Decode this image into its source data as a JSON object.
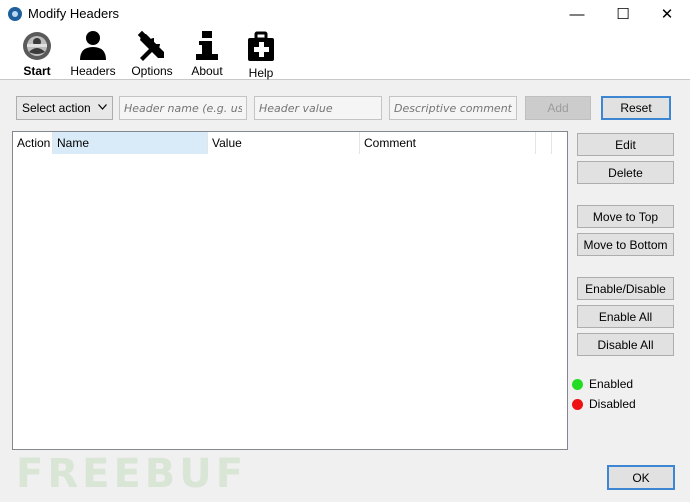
{
  "window": {
    "title": "Modify Headers",
    "controls": {
      "minimize": "—",
      "maximize": "☐",
      "close": "✕"
    }
  },
  "toolbar": {
    "items": [
      {
        "label": "Start",
        "icon": "start-icon"
      },
      {
        "label": "Headers",
        "icon": "user-icon"
      },
      {
        "label": "Options",
        "icon": "tools-icon"
      },
      {
        "label": "About",
        "icon": "info-icon"
      },
      {
        "label": "Help",
        "icon": "first-aid-kit-icon"
      }
    ]
  },
  "form": {
    "action_select": "Select action",
    "header_name_placeholder": "Header name (e.g. user",
    "header_value_placeholder": "Header value",
    "comment_placeholder": "Descriptive comment",
    "add_label": "Add",
    "reset_label": "Reset"
  },
  "table": {
    "columns": [
      "Action",
      "Name",
      "Value",
      "Comment"
    ],
    "rows": []
  },
  "side_buttons": {
    "edit": "Edit",
    "delete": "Delete",
    "move_top": "Move to Top",
    "move_bottom": "Move to Bottom",
    "enable_disable": "Enable/Disable",
    "enable_all": "Enable All",
    "disable_all": "Disable All"
  },
  "legend": {
    "enabled": {
      "label": "Enabled",
      "color": "#22dd22"
    },
    "disabled": {
      "label": "Disabled",
      "color": "#ee1111"
    }
  },
  "footer": {
    "ok_label": "OK"
  },
  "watermark": "FREEBUF"
}
